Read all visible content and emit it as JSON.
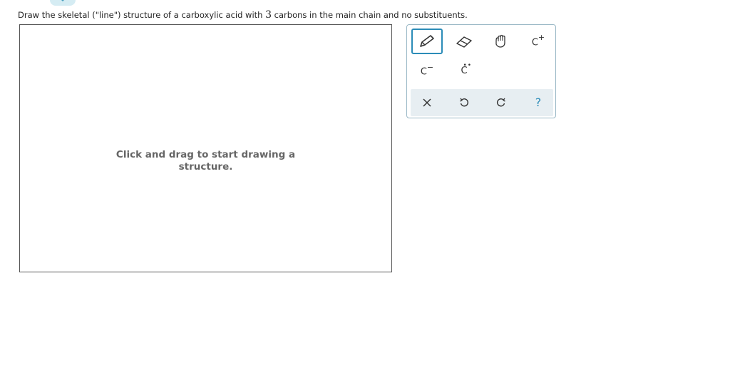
{
  "question": {
    "prefix": "Draw the skeletal (\"line\") structure of a carboxylic acid with ",
    "count": "3",
    "suffix": " carbons in the main chain and no substituents."
  },
  "canvas": {
    "hint_line1": "Click and drag to start drawing a",
    "hint_line2": "structure."
  },
  "toolbar": {
    "row1": [
      {
        "name": "pencil-tool",
        "icon": "pencil-icon",
        "active": true
      },
      {
        "name": "eraser-tool",
        "icon": "eraser-icon"
      },
      {
        "name": "hand-tool",
        "icon": "hand-icon"
      },
      {
        "name": "cation-tool",
        "icon": "carbocation-icon",
        "label": "C",
        "charge": "+"
      }
    ],
    "row2": [
      {
        "name": "anion-tool",
        "icon": "carbanion-icon",
        "label": "C",
        "charge": "−"
      },
      {
        "name": "lone-pair-tool",
        "icon": "lone-pair-carbon-icon",
        "label": "C"
      }
    ],
    "row3": [
      {
        "name": "clear-button",
        "icon": "close-icon"
      },
      {
        "name": "undo-button",
        "icon": "undo-icon"
      },
      {
        "name": "redo-button",
        "icon": "redo-icon"
      },
      {
        "name": "help-button",
        "icon": "help-icon",
        "label": "?"
      }
    ]
  },
  "colors": {
    "accent": "#2b8cb8",
    "toolbar_bar": "#e7eef2",
    "hint_text": "#666666"
  }
}
